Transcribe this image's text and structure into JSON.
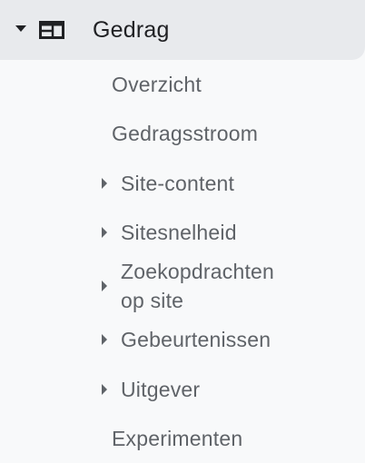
{
  "section": {
    "title": "Gedrag",
    "icon": "browser-layout-icon",
    "expanded": true
  },
  "items": [
    {
      "label": "Overzicht",
      "expandable": false
    },
    {
      "label": "Gedragsstroom",
      "expandable": false
    },
    {
      "label": "Site-content",
      "expandable": true
    },
    {
      "label": "Sitesnelheid",
      "expandable": true
    },
    {
      "label_line1": "Zoekopdrachten",
      "label_line2": "op site",
      "expandable": true
    },
    {
      "label": "Gebeurtenissen",
      "expandable": true
    },
    {
      "label": "Uitgever",
      "expandable": true
    },
    {
      "label": "Experimenten",
      "expandable": false
    }
  ],
  "colors": {
    "header_bg": "#e8eaed",
    "panel_bg": "#f8f9fa",
    "header_text": "#202124",
    "item_text": "#5f6368"
  }
}
